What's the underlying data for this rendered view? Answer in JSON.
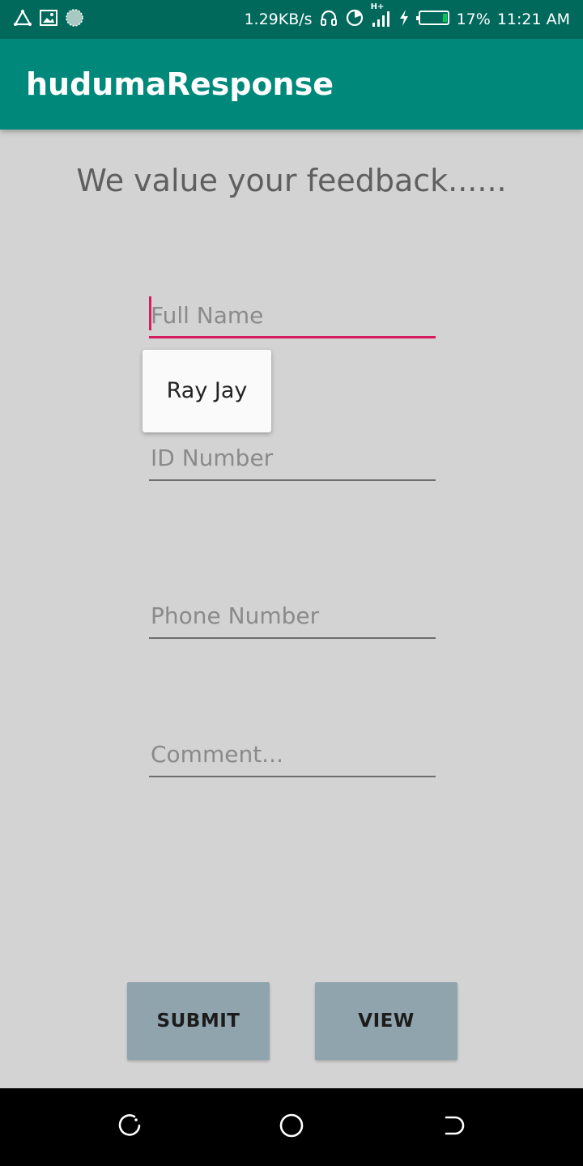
{
  "status_bar": {
    "net_speed": "1.29KB/s",
    "network_label": "H+",
    "battery_percent": "17%",
    "time": "11:21 AM",
    "icons": [
      "triangle-warning-icon",
      "screenshot-icon",
      "sync-circle-icon",
      "headphones-icon",
      "data-saver-icon",
      "signal-icon",
      "charging-bolt-icon",
      "battery-icon"
    ]
  },
  "app_bar": {
    "title": "hudumaResponse"
  },
  "main": {
    "headline": "We value your feedback......",
    "fields": {
      "full_name": {
        "placeholder": "Full Name",
        "value": ""
      },
      "id_number": {
        "placeholder": "ID Number",
        "value": ""
      },
      "phone_number": {
        "placeholder": "Phone Number",
        "value": ""
      },
      "comment": {
        "placeholder": "Comment...",
        "value": ""
      }
    },
    "autofill": {
      "suggestion": "Ray Jay"
    },
    "buttons": {
      "submit_label": "SUBMIT",
      "view_label": "VIEW"
    }
  },
  "nav_bar": {
    "icons": [
      "recent-apps-icon",
      "home-icon",
      "back-icon"
    ]
  },
  "colors": {
    "status_bar": "#00695c",
    "app_bar": "#00897b",
    "background": "#d3d3d3",
    "accent": "#d81b60",
    "button": "#90a4ae",
    "battery_level": "#00c853"
  }
}
